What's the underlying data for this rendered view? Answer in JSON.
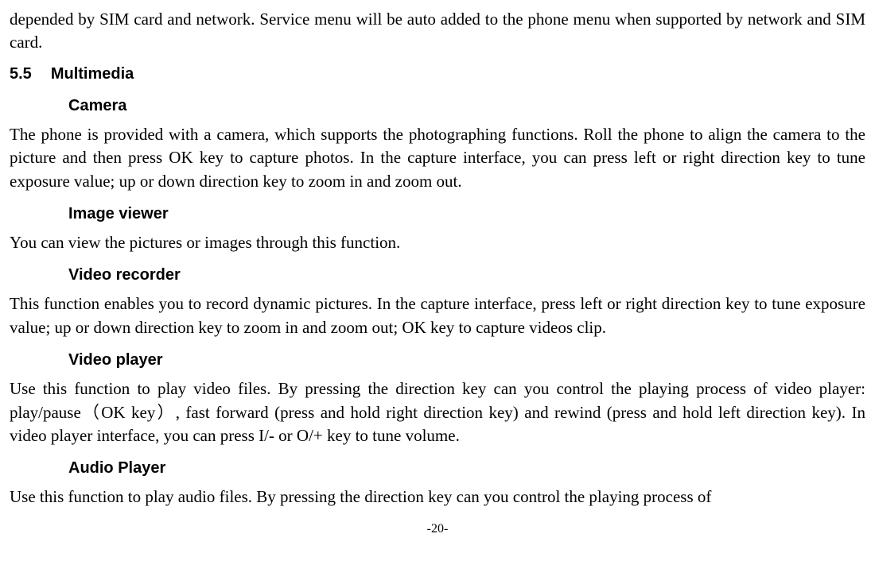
{
  "top_para": "depended by SIM card and network. Service menu will be auto added to the phone menu when supported by network and SIM card.",
  "section": {
    "number": "5.5",
    "title": "Multimedia"
  },
  "camera": {
    "heading": "Camera",
    "body": "The phone is provided with a camera, which supports the photographing functions. Roll the phone to align the camera to the picture and then press OK key to capture photos. In the capture interface, you can press left or right direction key to tune exposure value; up or down direction key to zoom in and zoom out."
  },
  "image_viewer": {
    "heading": "Image viewer",
    "body": "You can view the pictures or images through this function."
  },
  "video_recorder": {
    "heading": "Video recorder",
    "body": "This function enables you to record dynamic pictures. In the capture interface, press left or right direction key to tune exposure value; up or down direction key to zoom in and zoom out; OK key to capture videos clip."
  },
  "video_player": {
    "heading": "Video player",
    "body": "Use this function to play video files. By pressing the direction key can you control the playing process of video player: play/pause（OK key）, fast forward (press and hold right direction key) and rewind (press and hold left direction key). In video player interface, you can press I/- or O/+ key to tune volume."
  },
  "audio_player": {
    "heading": "Audio Player",
    "body": "Use this function to play audio files. By pressing the direction key can you control the playing process of"
  },
  "page_number": "-20-"
}
